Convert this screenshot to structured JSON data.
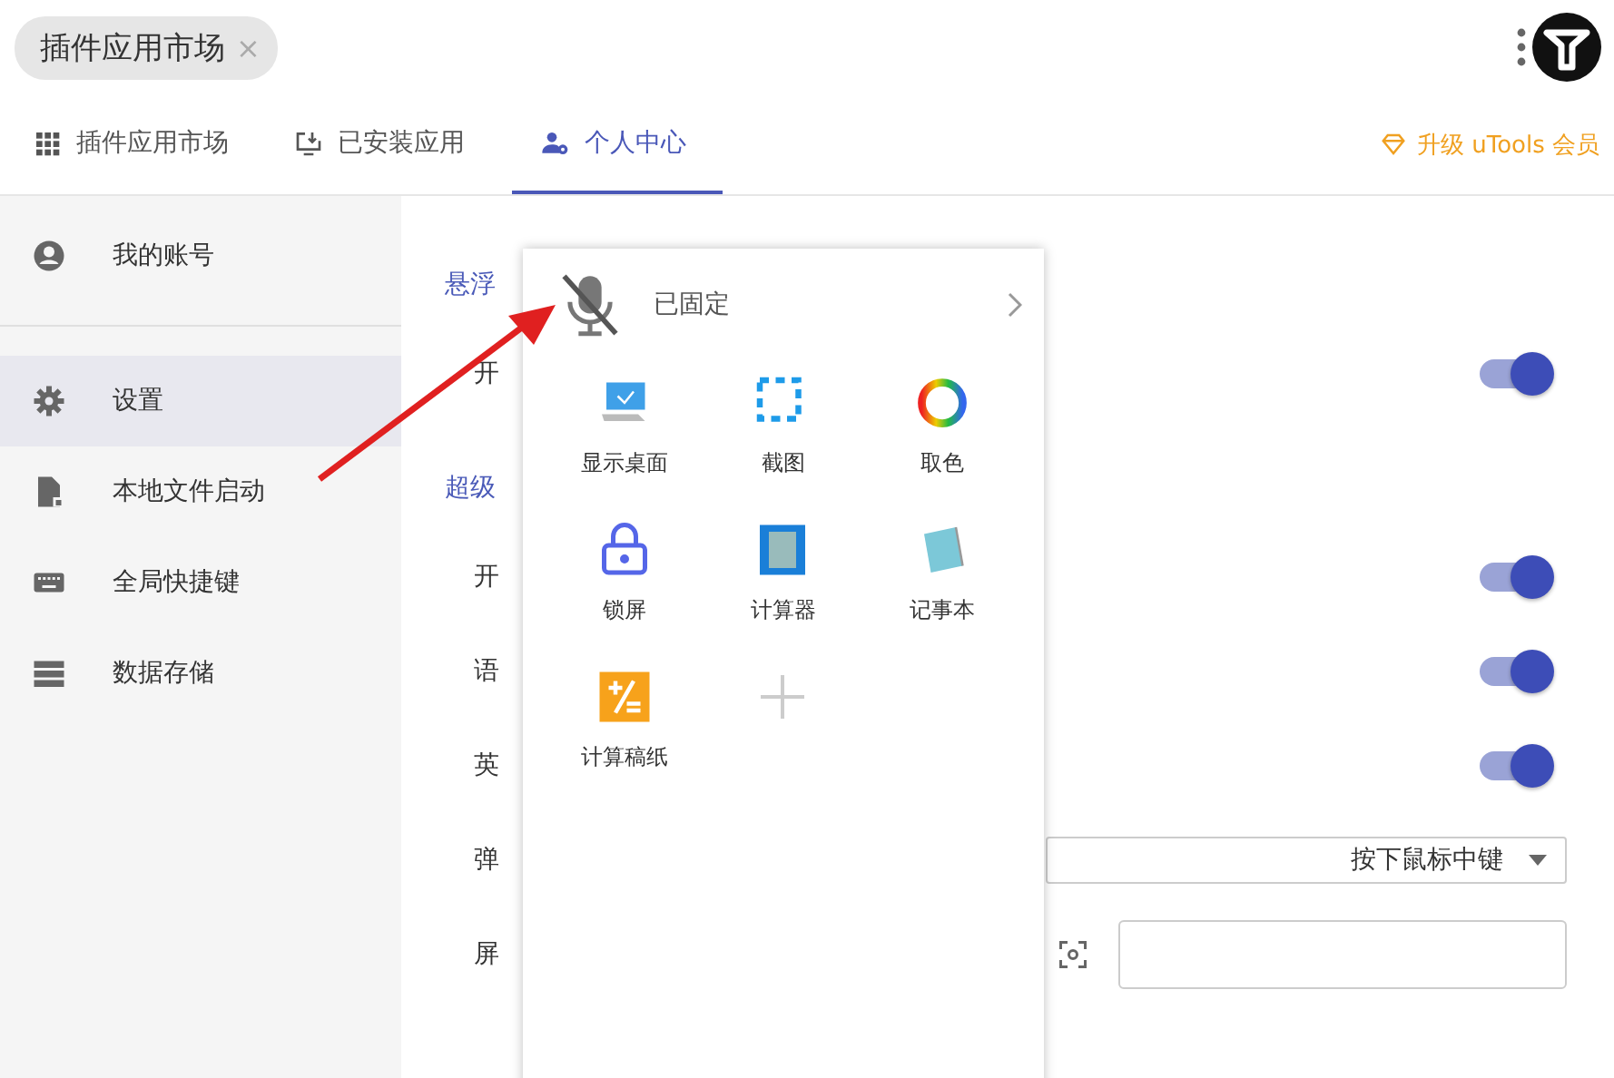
{
  "tab_chip": {
    "label": "插件应用市场",
    "close": "×"
  },
  "tabs": [
    {
      "label": "插件应用市场",
      "selected": false
    },
    {
      "label": "已安装应用",
      "selected": false
    },
    {
      "label": "个人中心",
      "selected": true
    }
  ],
  "upgrade_link": "升级 uTools 会员",
  "sidebar": {
    "items": [
      {
        "label": "我的账号",
        "selected": false
      },
      {
        "label": "设置",
        "selected": true
      },
      {
        "label": "本地文件启动",
        "selected": false
      },
      {
        "label": "全局快捷键",
        "selected": false
      },
      {
        "label": "数据存储",
        "selected": false
      }
    ]
  },
  "settings": [
    {
      "title": "悬浮",
      "rows": [
        {
          "kind": "toggle",
          "label": "开",
          "on": true
        }
      ]
    },
    {
      "title": "超级",
      "rows": [
        {
          "kind": "toggle",
          "label": "开",
          "on": true
        },
        {
          "kind": "toggle",
          "label": "语",
          "on": true
        },
        {
          "kind": "toggle",
          "label": "英",
          "on": true
        },
        {
          "kind": "select",
          "label": "弹",
          "value": "按下鼠标中键"
        },
        {
          "kind": "shortcut",
          "label": "屏"
        }
      ]
    }
  ],
  "popup": {
    "title": "已固定",
    "apps": [
      "显示桌面",
      "截图",
      "取色",
      "锁屏",
      "计算器",
      "记事本",
      "计算稿纸"
    ]
  }
}
